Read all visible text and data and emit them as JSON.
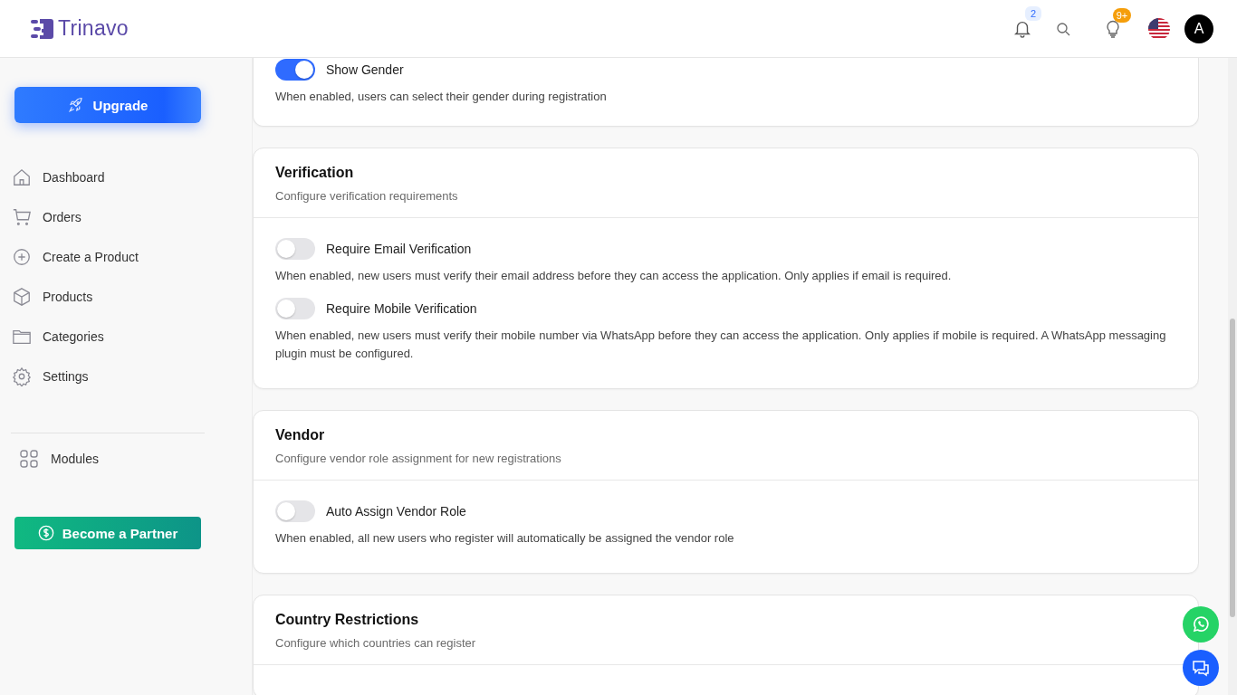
{
  "brand": {
    "name": "Trinavo"
  },
  "header": {
    "notification_count": "2",
    "tips_count": "9+",
    "avatar_letter": "A"
  },
  "sidebar": {
    "upgrade": "Upgrade",
    "items": [
      {
        "label": "Dashboard"
      },
      {
        "label": "Orders"
      },
      {
        "label": "Create a Product"
      },
      {
        "label": "Products"
      },
      {
        "label": "Categories"
      },
      {
        "label": "Settings"
      }
    ],
    "modules": "Modules",
    "partner": "Become a Partner"
  },
  "sections": [
    {
      "settings": [
        {
          "label": "Show Gender",
          "on": true,
          "description": "When enabled, users can select their gender during registration"
        }
      ]
    },
    {
      "title": "Verification",
      "subtitle": "Configure verification requirements",
      "settings": [
        {
          "label": "Require Email Verification",
          "on": false,
          "description": "When enabled, new users must verify their email address before they can access the application. Only applies if email is required."
        },
        {
          "label": "Require Mobile Verification",
          "on": false,
          "description": "When enabled, new users must verify their mobile number via WhatsApp before they can access the application. Only applies if mobile is required. A WhatsApp messaging plugin must be configured."
        }
      ]
    },
    {
      "title": "Vendor",
      "subtitle": "Configure vendor role assignment for new registrations",
      "settings": [
        {
          "label": "Auto Assign Vendor Role",
          "on": false,
          "description": "When enabled, all new users who register will automatically be assigned the vendor role"
        }
      ]
    },
    {
      "title": "Country Restrictions",
      "subtitle": "Configure which countries can register"
    }
  ]
}
